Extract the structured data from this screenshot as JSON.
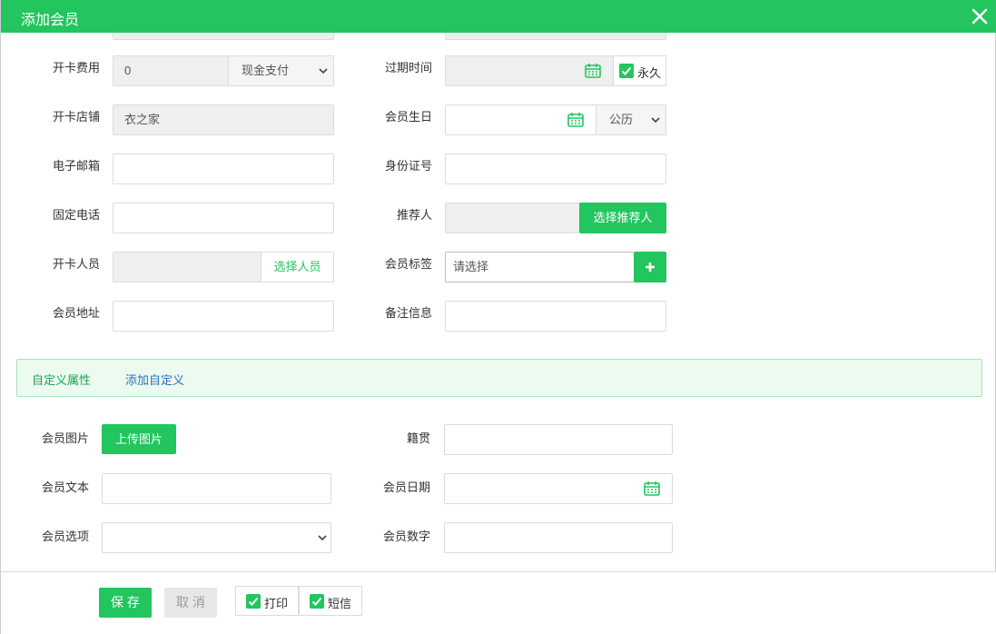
{
  "dialog": {
    "title": "添加会员",
    "close_icon": "close-icon"
  },
  "form": {
    "card_fee": {
      "label": "开卡费用",
      "value": "0",
      "payment_selected": "现金支付"
    },
    "expire_time": {
      "label": "过期时间",
      "value": "",
      "permanent_label": "永久"
    },
    "store": {
      "label": "开卡店铺",
      "value": "衣之家"
    },
    "birthday": {
      "label": "会员生日",
      "value": "",
      "calendar_selected": "公历"
    },
    "email": {
      "label": "电子邮箱",
      "value": ""
    },
    "id_number": {
      "label": "身份证号",
      "value": ""
    },
    "phone": {
      "label": "固定电话",
      "value": ""
    },
    "referrer": {
      "label": "推荐人",
      "value": "",
      "button": "选择推荐人"
    },
    "opener": {
      "label": "开卡人员",
      "value": "",
      "button": "选择人员"
    },
    "tags": {
      "label": "会员标签",
      "placeholder": "请选择",
      "add_icon": "plus-icon"
    },
    "address": {
      "label": "会员地址",
      "value": ""
    },
    "remark": {
      "label": "备注信息",
      "value": ""
    }
  },
  "custom": {
    "title": "自定义属性",
    "add_link": "添加自定义"
  },
  "custom_fields": {
    "picture": {
      "label": "会员图片",
      "button": "上传图片"
    },
    "origin": {
      "label": "籍贯",
      "value": ""
    },
    "text": {
      "label": "会员文本",
      "value": ""
    },
    "date": {
      "label": "会员日期",
      "value": ""
    },
    "option": {
      "label": "会员选项",
      "value": ""
    },
    "number": {
      "label": "会员数字",
      "value": ""
    }
  },
  "footer": {
    "save": "保 存",
    "cancel": "取 消",
    "print": "打印",
    "sms": "短信"
  },
  "colors": {
    "accent": "#22c55e",
    "link": "#2a6fbb"
  }
}
